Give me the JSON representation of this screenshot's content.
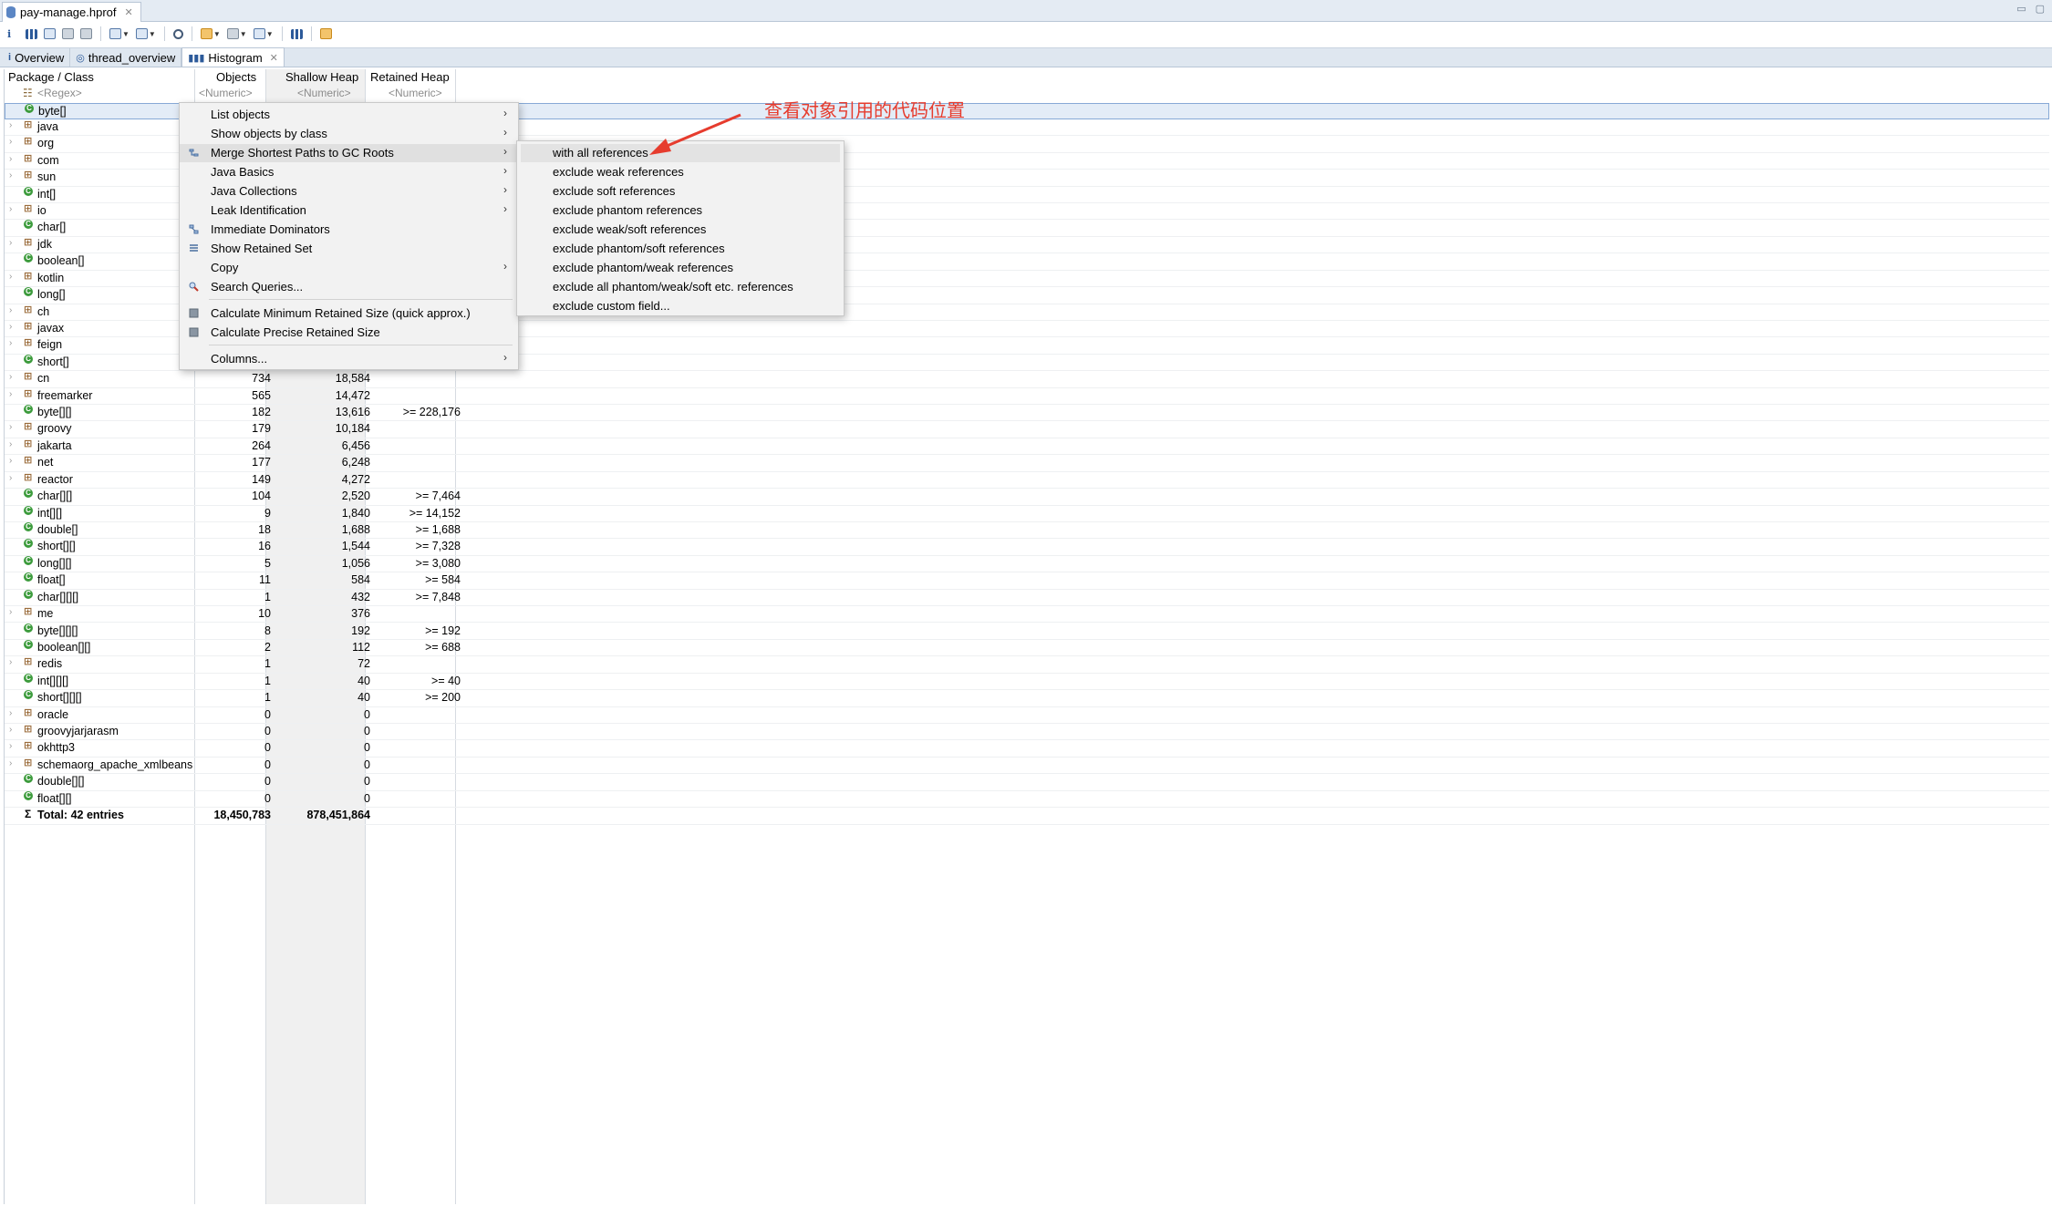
{
  "editor_tab": {
    "label": "pay-manage.hprof",
    "close": "✕"
  },
  "view_tabs": [
    {
      "label": "Overview",
      "icon": "i"
    },
    {
      "label": "thread_overview",
      "icon": "◎"
    },
    {
      "label": "Histogram",
      "icon": "▮▮▮"
    }
  ],
  "view_tab_close": "✕",
  "columns": {
    "class": "Package / Class",
    "objects": "Objects",
    "shallow": "Shallow Heap",
    "retained": "Retained Heap"
  },
  "filters": {
    "class": "<Regex>",
    "objects": "<Numeric>",
    "shallow": "<Numeric>",
    "retained": "<Numeric>"
  },
  "rows": [
    {
      "name": "byte[]",
      "kind": "class",
      "expandable": false,
      "objects": "",
      "shallow": "",
      "retained": ""
    },
    {
      "name": "java",
      "kind": "package",
      "expandable": true,
      "objects": "",
      "shallow": "",
      "retained": ""
    },
    {
      "name": "org",
      "kind": "package",
      "expandable": true,
      "objects": "",
      "shallow": "",
      "retained": ""
    },
    {
      "name": "com",
      "kind": "package",
      "expandable": true,
      "objects": "",
      "shallow": "",
      "retained": ""
    },
    {
      "name": "sun",
      "kind": "package",
      "expandable": true,
      "objects": "",
      "shallow": "",
      "retained": ""
    },
    {
      "name": "int[]",
      "kind": "class",
      "expandable": false,
      "objects": "",
      "shallow": "",
      "retained": ""
    },
    {
      "name": "io",
      "kind": "package",
      "expandable": true,
      "objects": "",
      "shallow": "",
      "retained": ""
    },
    {
      "name": "char[]",
      "kind": "class",
      "expandable": false,
      "objects": "",
      "shallow": "",
      "retained": ""
    },
    {
      "name": "jdk",
      "kind": "package",
      "expandable": true,
      "objects": "",
      "shallow": "",
      "retained": ""
    },
    {
      "name": "boolean[]",
      "kind": "class",
      "expandable": false,
      "objects": "",
      "shallow": "",
      "retained": ""
    },
    {
      "name": "kotlin",
      "kind": "package",
      "expandable": true,
      "objects": "",
      "shallow": "",
      "retained": ""
    },
    {
      "name": "long[]",
      "kind": "class",
      "expandable": false,
      "objects": "",
      "shallow": "",
      "retained": ""
    },
    {
      "name": "ch",
      "kind": "package",
      "expandable": true,
      "objects": "",
      "shallow": "",
      "retained": ""
    },
    {
      "name": "javax",
      "kind": "package",
      "expandable": true,
      "objects": "",
      "shallow": "",
      "retained": ""
    },
    {
      "name": "feign",
      "kind": "package",
      "expandable": true,
      "objects": "",
      "shallow": "",
      "retained": ""
    },
    {
      "name": "short[]",
      "kind": "class",
      "expandable": false,
      "objects": "",
      "shallow": "",
      "retained": ""
    },
    {
      "name": "cn",
      "kind": "package",
      "expandable": true,
      "objects": "734",
      "shallow": "18,584",
      "retained": ""
    },
    {
      "name": "freemarker",
      "kind": "package",
      "expandable": true,
      "objects": "565",
      "shallow": "14,472",
      "retained": ""
    },
    {
      "name": "byte[][]",
      "kind": "class",
      "expandable": false,
      "objects": "182",
      "shallow": "13,616",
      "retained": ">= 228,176"
    },
    {
      "name": "groovy",
      "kind": "package",
      "expandable": true,
      "objects": "179",
      "shallow": "10,184",
      "retained": ""
    },
    {
      "name": "jakarta",
      "kind": "package",
      "expandable": true,
      "objects": "264",
      "shallow": "6,456",
      "retained": ""
    },
    {
      "name": "net",
      "kind": "package",
      "expandable": true,
      "objects": "177",
      "shallow": "6,248",
      "retained": ""
    },
    {
      "name": "reactor",
      "kind": "package",
      "expandable": true,
      "objects": "149",
      "shallow": "4,272",
      "retained": ""
    },
    {
      "name": "char[][]",
      "kind": "class",
      "expandable": false,
      "objects": "104",
      "shallow": "2,520",
      "retained": ">= 7,464"
    },
    {
      "name": "int[][]",
      "kind": "class",
      "expandable": false,
      "objects": "9",
      "shallow": "1,840",
      "retained": ">= 14,152"
    },
    {
      "name": "double[]",
      "kind": "class",
      "expandable": false,
      "objects": "18",
      "shallow": "1,688",
      "retained": ">= 1,688"
    },
    {
      "name": "short[][]",
      "kind": "class",
      "expandable": false,
      "objects": "16",
      "shallow": "1,544",
      "retained": ">= 7,328"
    },
    {
      "name": "long[][]",
      "kind": "class",
      "expandable": false,
      "objects": "5",
      "shallow": "1,056",
      "retained": ">= 3,080"
    },
    {
      "name": "float[]",
      "kind": "class",
      "expandable": false,
      "objects": "11",
      "shallow": "584",
      "retained": ">= 584"
    },
    {
      "name": "char[][][]",
      "kind": "class",
      "expandable": false,
      "objects": "1",
      "shallow": "432",
      "retained": ">= 7,848"
    },
    {
      "name": "me",
      "kind": "package",
      "expandable": true,
      "objects": "10",
      "shallow": "376",
      "retained": ""
    },
    {
      "name": "byte[][][]",
      "kind": "class",
      "expandable": false,
      "objects": "8",
      "shallow": "192",
      "retained": ">= 192"
    },
    {
      "name": "boolean[][]",
      "kind": "class",
      "expandable": false,
      "objects": "2",
      "shallow": "112",
      "retained": ">= 688"
    },
    {
      "name": "redis",
      "kind": "package",
      "expandable": true,
      "objects": "1",
      "shallow": "72",
      "retained": ""
    },
    {
      "name": "int[][][]",
      "kind": "class",
      "expandable": false,
      "objects": "1",
      "shallow": "40",
      "retained": ">= 40"
    },
    {
      "name": "short[][][]",
      "kind": "class",
      "expandable": false,
      "objects": "1",
      "shallow": "40",
      "retained": ">= 200"
    },
    {
      "name": "oracle",
      "kind": "package",
      "expandable": true,
      "objects": "0",
      "shallow": "0",
      "retained": ""
    },
    {
      "name": "groovyjarjarasm",
      "kind": "package",
      "expandable": true,
      "objects": "0",
      "shallow": "0",
      "retained": ""
    },
    {
      "name": "okhttp3",
      "kind": "package",
      "expandable": true,
      "objects": "0",
      "shallow": "0",
      "retained": ""
    },
    {
      "name": "schemaorg_apache_xmlbeans",
      "kind": "package",
      "expandable": true,
      "objects": "0",
      "shallow": "0",
      "retained": ""
    },
    {
      "name": "double[][]",
      "kind": "class",
      "expandable": false,
      "objects": "0",
      "shallow": "0",
      "retained": ""
    },
    {
      "name": "float[][]",
      "kind": "class",
      "expandable": false,
      "objects": "0",
      "shallow": "0",
      "retained": ""
    }
  ],
  "total": {
    "label": "Total: 42 entries",
    "objects": "18,450,783",
    "shallow": "878,451,864",
    "retained": ""
  },
  "context_menu": {
    "items": [
      {
        "label": "List objects",
        "submenu": true,
        "icon": ""
      },
      {
        "label": "Show objects by class",
        "submenu": true,
        "icon": ""
      },
      {
        "label": "Merge Shortest Paths to GC Roots",
        "submenu": true,
        "icon": "paths-icon"
      },
      {
        "label": "Java Basics",
        "submenu": true,
        "icon": ""
      },
      {
        "label": "Java Collections",
        "submenu": true,
        "icon": ""
      },
      {
        "label": "Leak Identification",
        "submenu": true,
        "icon": ""
      },
      {
        "label": "Immediate Dominators",
        "submenu": false,
        "icon": "dominator-icon"
      },
      {
        "label": "Show Retained Set",
        "submenu": false,
        "icon": "retained-set-icon"
      },
      {
        "label": "Copy",
        "submenu": true,
        "icon": ""
      },
      {
        "label": "Search Queries...",
        "submenu": false,
        "icon": "search-queries-icon"
      },
      {
        "label": "Calculate Minimum Retained Size (quick approx.)",
        "submenu": false,
        "icon": "calc-icon"
      },
      {
        "label": "Calculate Precise Retained Size",
        "submenu": false,
        "icon": "calc-icon"
      },
      {
        "label": "Columns...",
        "submenu": true,
        "icon": ""
      }
    ],
    "arrow": "›"
  },
  "sub_menu": {
    "items": [
      "with all references",
      "exclude weak references",
      "exclude soft references",
      "exclude phantom references",
      "exclude weak/soft references",
      "exclude phantom/soft references",
      "exclude phantom/weak references",
      "exclude all phantom/weak/soft etc. references",
      "exclude custom field..."
    ]
  },
  "annotation": {
    "text": "查看对象引用的代码位置",
    "color": "#e63c2e"
  },
  "colors": {
    "selected_row": "#e3ecf7",
    "class_icon": "#3c9b3c",
    "package_icon": "#9a6b3a"
  }
}
